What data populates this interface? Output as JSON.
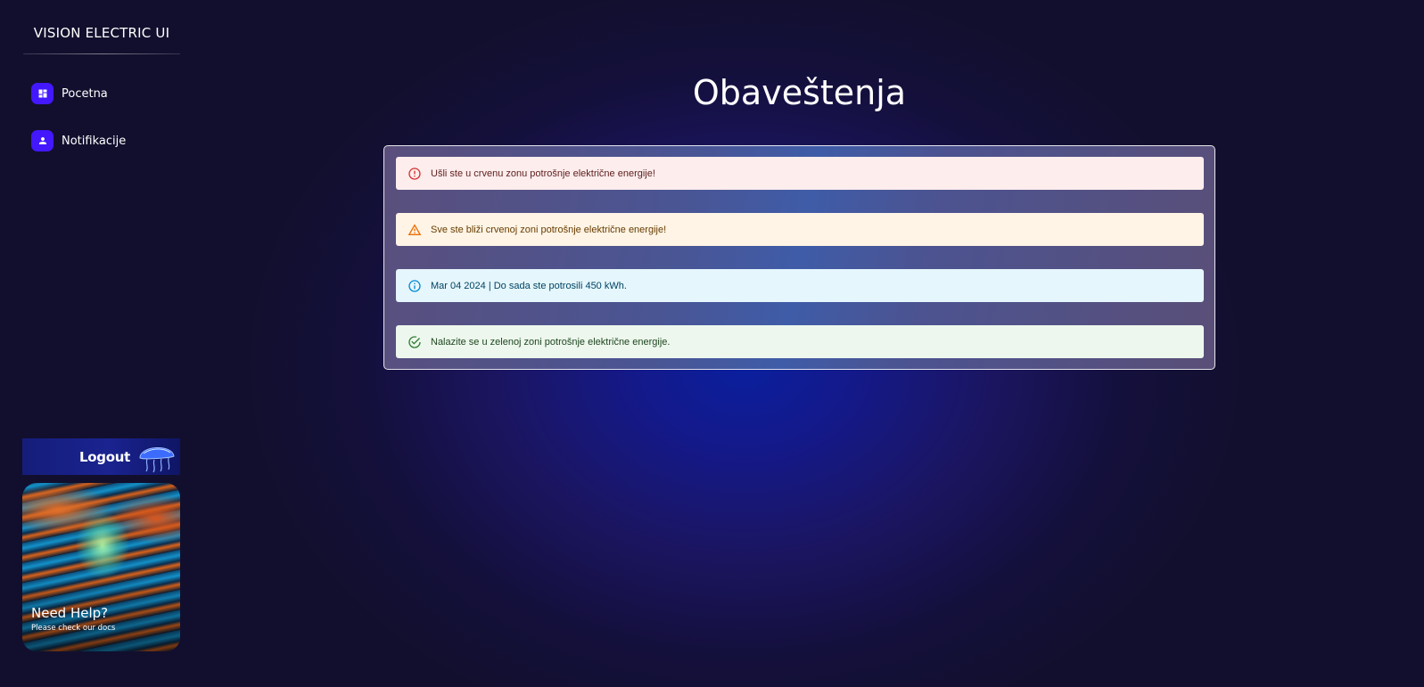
{
  "sidebar": {
    "brand": "VISION ELECTRIC UI",
    "items": [
      {
        "label": "Pocetna",
        "icon": "dashboard-icon"
      },
      {
        "label": "Notifikacije",
        "icon": "person-icon"
      }
    ],
    "logout_label": "Logout",
    "help": {
      "title": "Need Help?",
      "subtitle": "Please check our docs"
    }
  },
  "main": {
    "title": "Obaveštenja",
    "alerts": [
      {
        "severity": "error",
        "icon": "error-outline-icon",
        "color": "#d32f2f",
        "text": "Ušli ste u crvenu zonu potrošnje električne energije!"
      },
      {
        "severity": "warning",
        "icon": "warning-triangle-icon",
        "color": "#ed6c02",
        "text": "Sve ste bliži crvenoj zoni potrošnje električne energije!"
      },
      {
        "severity": "info",
        "icon": "info-outline-icon",
        "color": "#0288d1",
        "text": "Mar 04 2024 | Do sada ste potrosili 450 kWh."
      },
      {
        "severity": "success",
        "icon": "check-circle-outline-icon",
        "color": "#2e7d32",
        "text": "Nalazite se u zelenoj zoni potrošnje električne energije."
      }
    ]
  },
  "colors": {
    "accent": "#4318ff",
    "background": "#120f2e"
  }
}
